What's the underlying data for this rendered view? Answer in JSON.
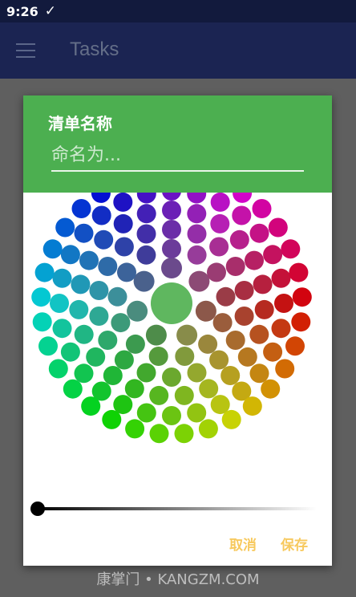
{
  "status_bar": {
    "time": "9:26",
    "check_icon": "✓"
  },
  "app_bar": {
    "title": "Tasks",
    "menu_icon": "hamburger-icon"
  },
  "dialog": {
    "title": "清单名称",
    "name_placeholder": "命名为...",
    "name_value": "",
    "header_color": "#4caf50",
    "selected_color": "#5fb75f",
    "brightness_slider_value": 0,
    "buttons": {
      "cancel": "取消",
      "save": "保存"
    },
    "button_color": "#f7c95e"
  },
  "watermark": "康掌门 • KANGZM.COM"
}
